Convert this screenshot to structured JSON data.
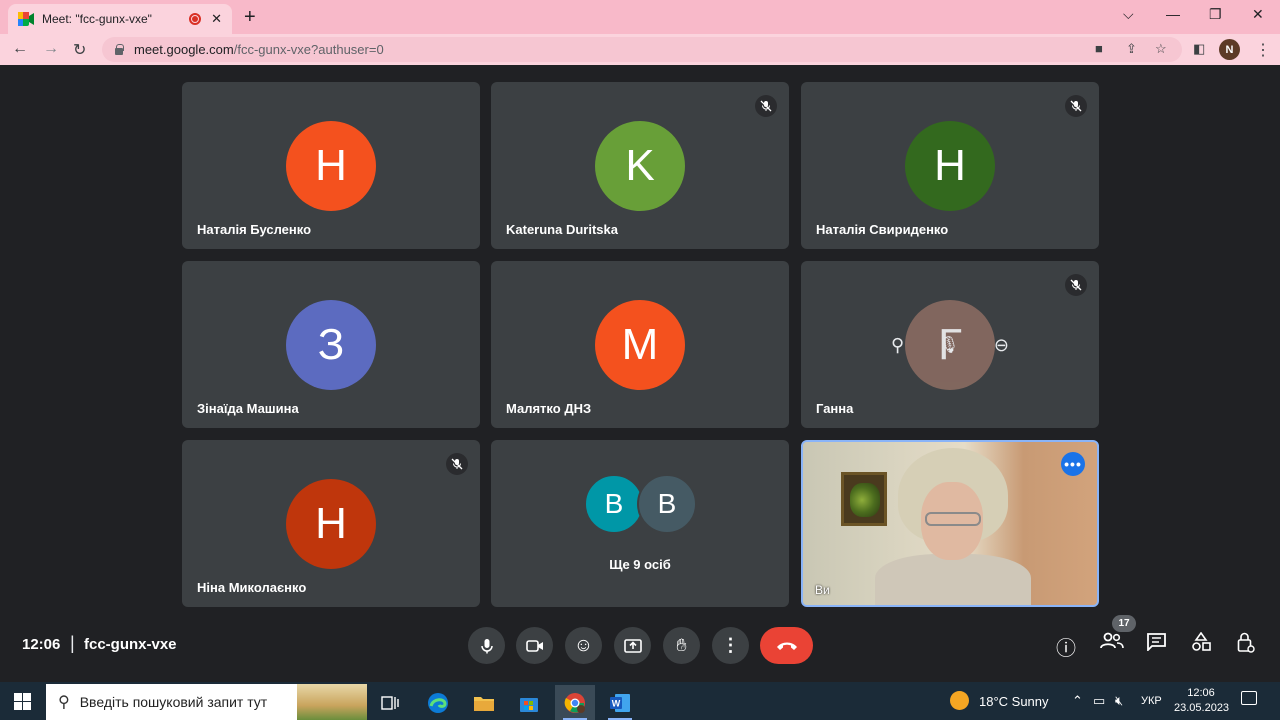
{
  "browser": {
    "tab_title": "Meet: \"fcc-gunx-vxe\"",
    "tab_close": "✕",
    "new_tab": "+",
    "url_host": "meet.google.com",
    "url_path": "/fcc-gunx-vxe?authuser=0",
    "profile_initial": "N"
  },
  "participants": [
    {
      "name": "Наталія Бусленко",
      "initial": "Н",
      "color": "#f4511e",
      "muted": false
    },
    {
      "name": "Kateruna Duritska",
      "initial": "K",
      "color": "#689f38",
      "muted": true
    },
    {
      "name": "Наталія Свириденко",
      "initial": "Н",
      "color": "#33691e",
      "muted": true
    },
    {
      "name": "Зінаїда Машина",
      "initial": "З",
      "color": "#5c6bc0",
      "muted": false
    },
    {
      "name": "Малятко ДНЗ",
      "initial": "М",
      "color": "#f4511e",
      "muted": false
    },
    {
      "name": "Ганна",
      "initial": "Г",
      "color": "#8d6e63",
      "muted": true
    },
    {
      "name": "Ніна Миколаєнко",
      "initial": "Н",
      "color": "#bf360c",
      "muted": true
    }
  ],
  "more_tile": {
    "avatars": [
      {
        "initial": "В",
        "color": "#0097a7"
      },
      {
        "initial": "В",
        "color": "#455a64"
      }
    ],
    "label": "Ще 9 осіб"
  },
  "self_tile": {
    "name": "Ви"
  },
  "meeting": {
    "time": "12:06",
    "separator": "|",
    "code": "fcc-gunx-vxe",
    "people_count": "17"
  },
  "taskbar": {
    "search_placeholder": "Введіть пошуковий запит тут",
    "weather": "18°C  Sunny",
    "language": "УКР",
    "time": "12:06",
    "date": "23.05.2023"
  }
}
